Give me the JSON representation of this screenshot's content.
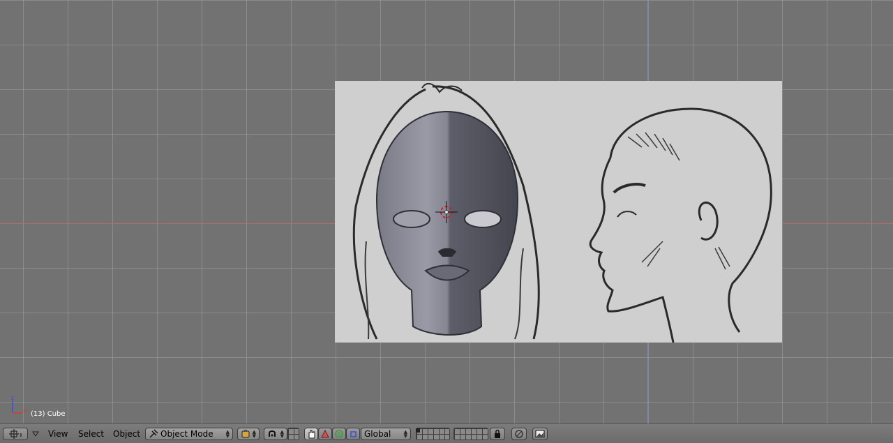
{
  "viewport": {
    "object_label": "(13) Cube",
    "axis_labels": {
      "z": "z",
      "x": "x"
    }
  },
  "header": {
    "menus": {
      "view": "View",
      "select": "Select",
      "object": "Object"
    },
    "mode_selector": {
      "value": "Object Mode"
    },
    "orientation_selector": {
      "value": "Global"
    }
  },
  "colors": {
    "viewport_bg": "#727272",
    "grid_line": "#9e9e9e",
    "x_axis": "#b06d6d",
    "y_axis": "#7f88a8",
    "header_bg": "#747474",
    "reference_bg": "#cfcfcf"
  },
  "icons": [
    "editor-type-icon",
    "menu-collapse-icon",
    "object-mode-icon",
    "viewport-shading-icon",
    "pivot-point-icon",
    "transform-manipulator-icon",
    "translate-icon",
    "rotate-icon",
    "scale-icon",
    "layers-icon",
    "lock-icon",
    "snap-icon",
    "render-icon"
  ]
}
